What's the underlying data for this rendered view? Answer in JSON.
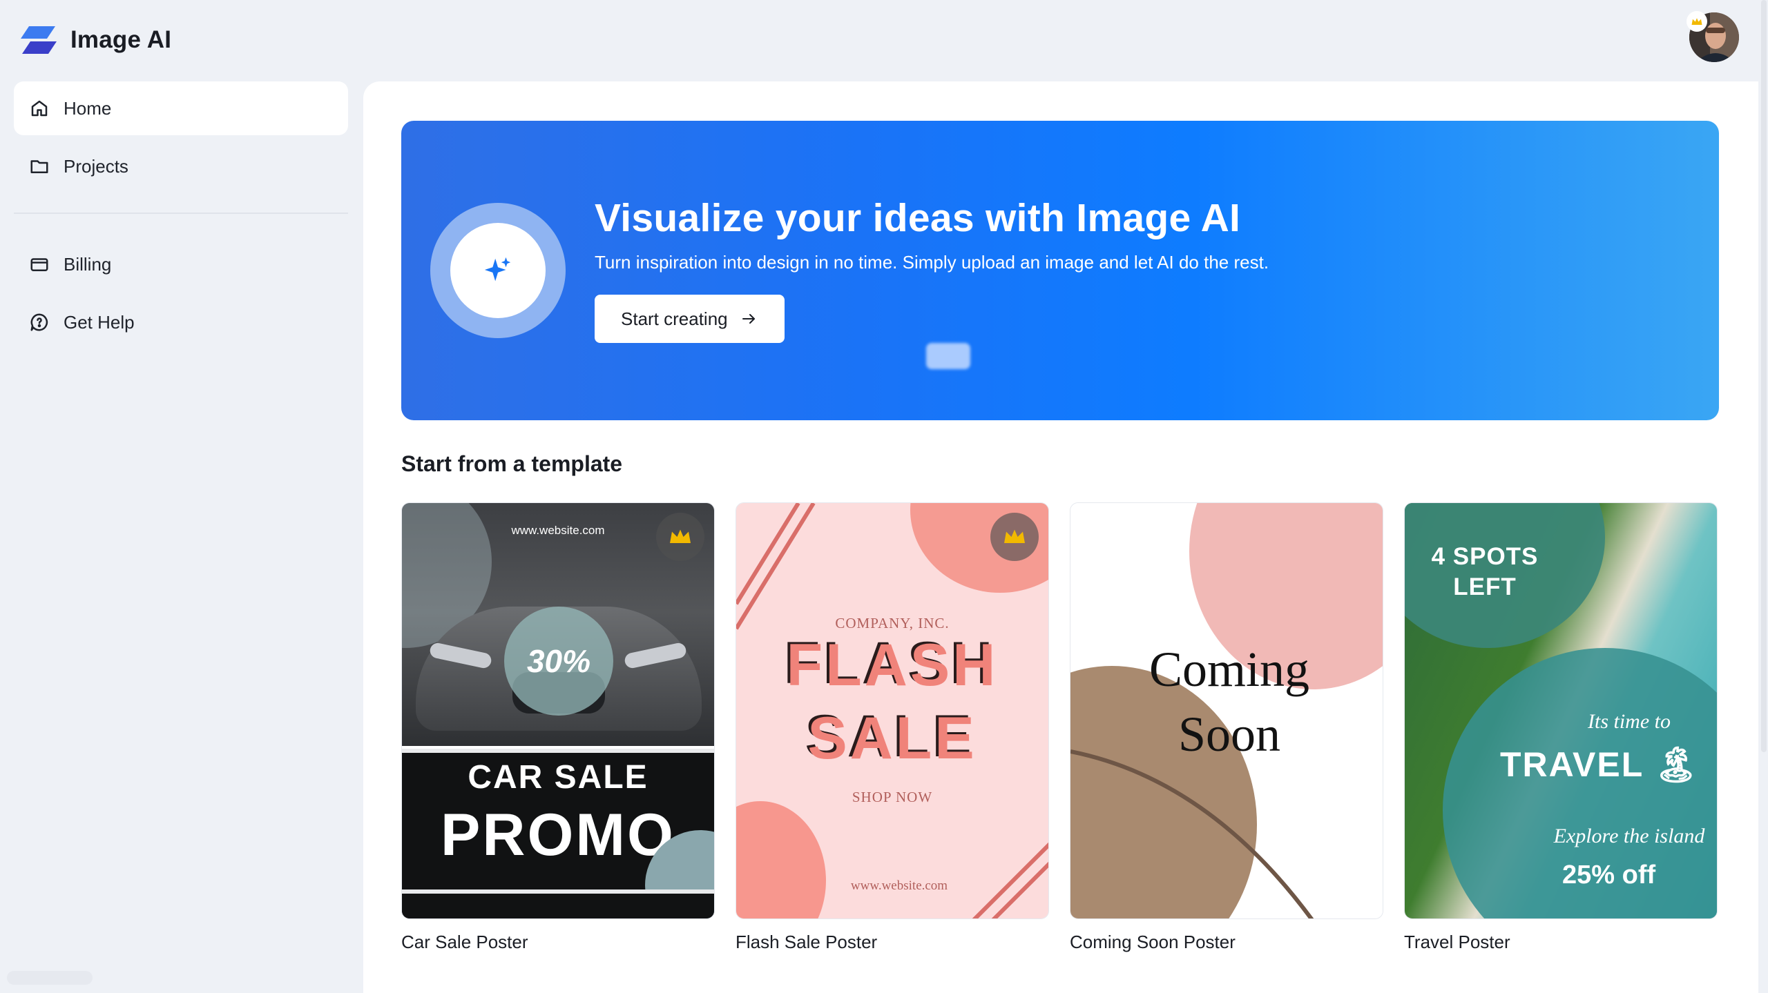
{
  "app": {
    "name": "Image AI",
    "colors": {
      "accent": "#0e7cff",
      "brand_logo": "#3a5bd9",
      "premium_crown": "#f2b900"
    }
  },
  "header": {
    "avatar_icon": "user-avatar",
    "premium_badge_icon": "crown-icon"
  },
  "sidebar": {
    "items": [
      {
        "label": "Home",
        "icon": "home-icon",
        "active": true
      },
      {
        "label": "Projects",
        "icon": "folder-icon",
        "active": false
      }
    ],
    "secondary_items": [
      {
        "label": "Billing",
        "icon": "credit-card-icon"
      },
      {
        "label": "Get Help",
        "icon": "help-chat-icon"
      }
    ]
  },
  "hero": {
    "title": "Visualize your ideas with Image AI",
    "subtitle": "Turn inspiration into design in no time. Simply upload an image and let AI do the rest.",
    "cta_label": "Start creating",
    "icon": "sparkles-icon"
  },
  "templates": {
    "section_title": "Start from a template",
    "items": [
      {
        "label": "Car Sale Poster",
        "premium": true,
        "poster": {
          "url": "www.website.com",
          "discount": "30%",
          "line1": "CAR SALE",
          "line2": "PROMO"
        }
      },
      {
        "label": "Flash Sale Poster",
        "premium": true,
        "poster": {
          "company": "COMPANY, INC.",
          "line1": "FLASH",
          "line2": "SALE",
          "shop": "SHOP NOW",
          "url": "www.website.com"
        }
      },
      {
        "label": "Coming Soon Poster",
        "premium": false,
        "poster": {
          "line1": "Coming",
          "line2": "Soon"
        }
      },
      {
        "label": "Travel Poster",
        "premium": false,
        "poster": {
          "spots": "4 SPOTS LEFT",
          "script1": "Its time to",
          "big": "TRAVEL 🏝",
          "script2": "Explore the island",
          "offer": "25% off"
        }
      }
    ]
  }
}
